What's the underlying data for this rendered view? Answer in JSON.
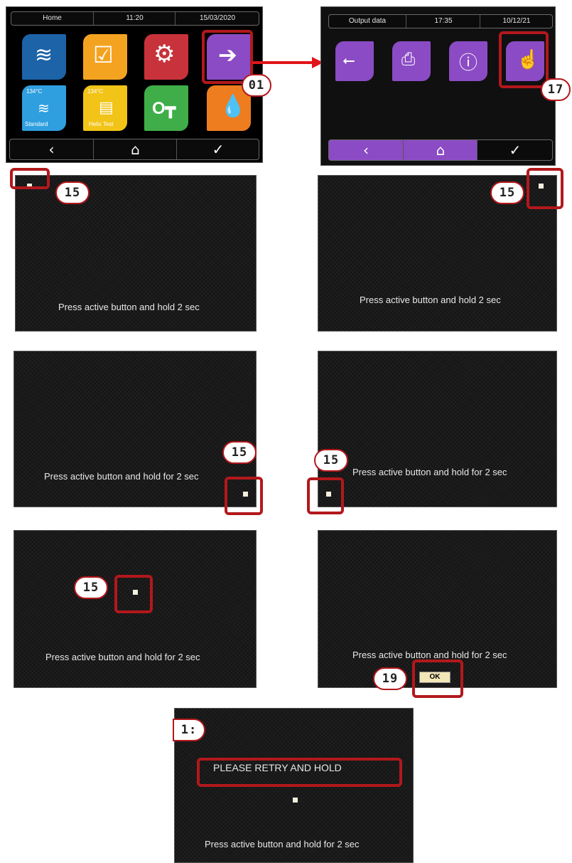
{
  "screen1": {
    "tabs": [
      "Home",
      "11:20",
      "15/03/2020"
    ],
    "tiles": [
      {
        "icon": "heat-icon",
        "color": "#1d63a8"
      },
      {
        "icon": "checklist-icon",
        "color": "#f4a321"
      },
      {
        "icon": "settings-gears-icon",
        "color": "#c8323a"
      },
      {
        "icon": "output-arrow-icon",
        "color": "#8b4bc4"
      },
      {
        "icon": "steam-icon",
        "color": "#2f9fe0",
        "top_text": "134°C",
        "bottom_text": "Standard"
      },
      {
        "icon": "document-icon",
        "color": "#f2c417",
        "top_text": "134°C",
        "bottom_text": "Helix Test"
      },
      {
        "icon": "key-icon",
        "color": "#3fae48"
      },
      {
        "icon": "water-drop-icon",
        "color": "#ee7d20"
      }
    ],
    "nav": [
      "‹",
      "⌂",
      "✓"
    ]
  },
  "screen2": {
    "tabs": [
      "Output data",
      "17:35",
      "10/12/21"
    ],
    "tiles": [
      {
        "icon": "usb-icon",
        "color": "#8b4bc4"
      },
      {
        "icon": "printer-icon",
        "color": "#8b4bc4"
      },
      {
        "icon": "info-icon",
        "color": "#8b4bc4"
      },
      {
        "icon": "touch-calibration-icon",
        "color": "#8b4bc4"
      }
    ],
    "nav": [
      "‹",
      "⌂",
      "✓"
    ]
  },
  "callouts": {
    "c01": "01",
    "c17": "17",
    "c15a": "15",
    "c15b": "15",
    "c15c": "15",
    "c15d": "15",
    "c15e": "15",
    "c19": "19",
    "c1x": "1:"
  },
  "messages": {
    "p1": "Press active button and hold 2 sec",
    "p2": "Press active button and hold 2 sec",
    "p3": "Press active button and hold for 2 sec",
    "p4": "Press active button and hold for 2 sec",
    "p5": "Press active button and hold for 2 sec",
    "p6": "Press active button and hold for 2 sec",
    "p7": "Press active button and hold for 2 sec",
    "retry": "PLEASE RETRY AND HOLD",
    "ok": "OK"
  },
  "colors": {
    "highlight": "#b2181c",
    "arrow": "#e0151b",
    "purple": "#8b4bc4"
  }
}
